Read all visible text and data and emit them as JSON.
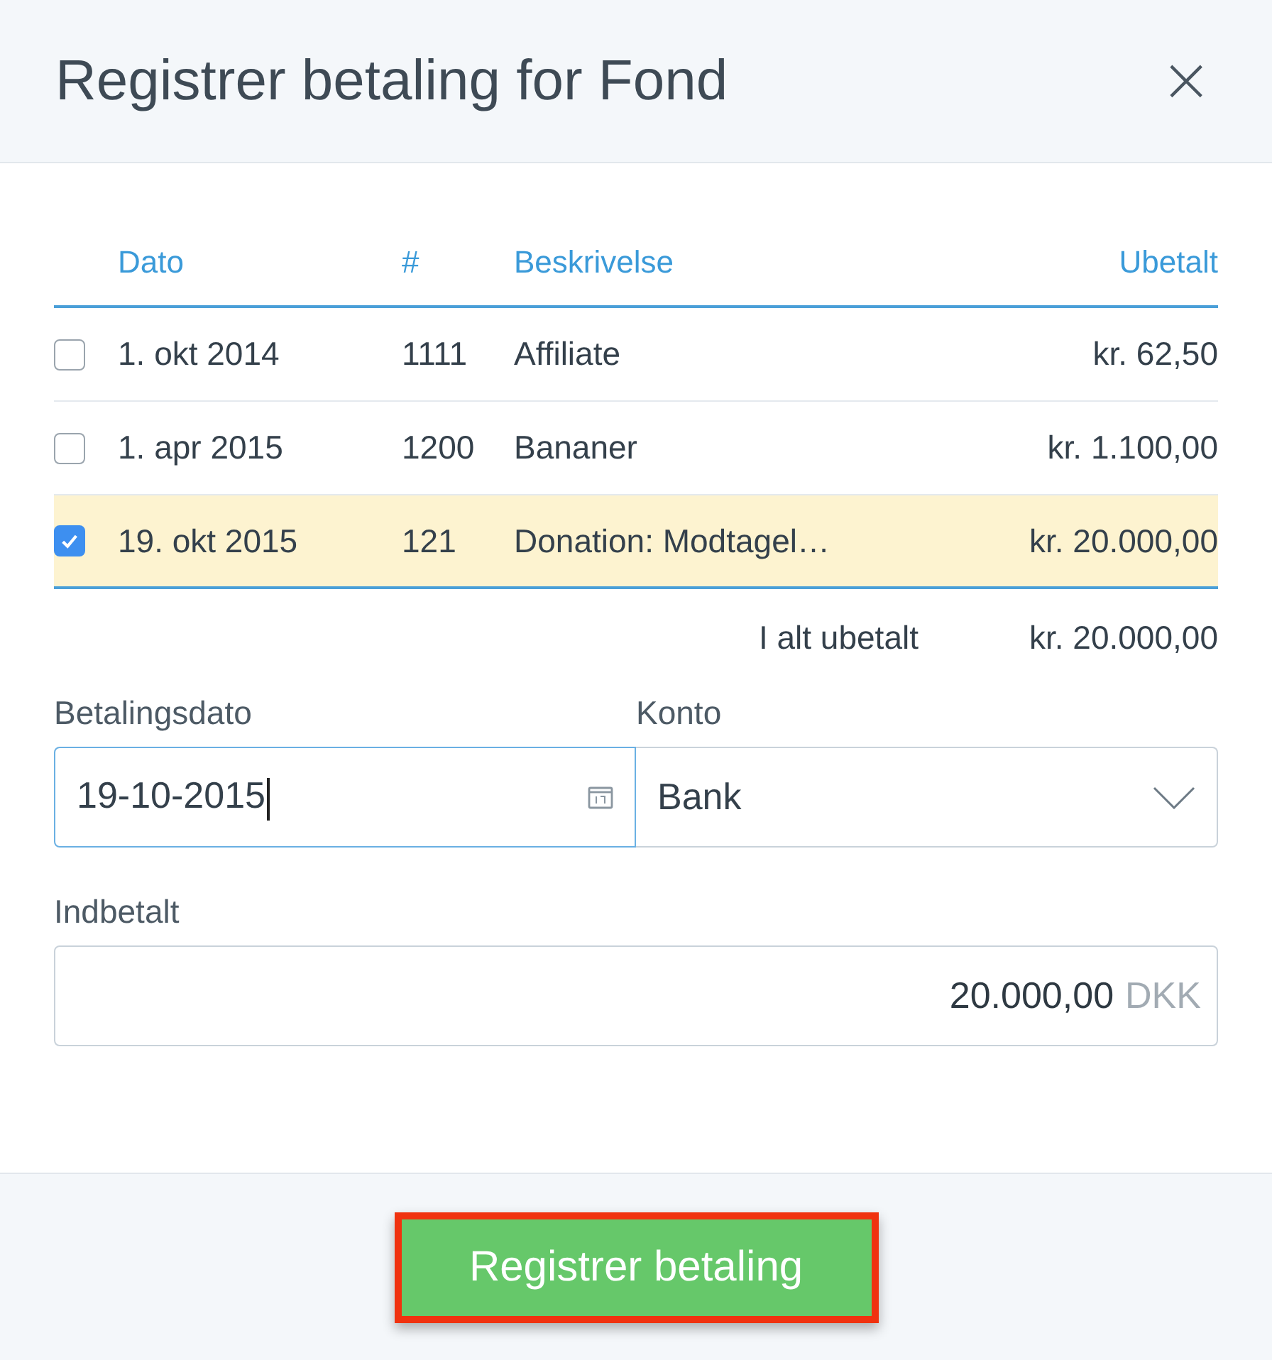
{
  "dialog": {
    "title": "Registrer betaling for Fond",
    "close": "×"
  },
  "table": {
    "columns": [
      "Dato",
      "#",
      "Beskrivelse",
      "Ubetalt"
    ],
    "rows": [
      {
        "selected": false,
        "date": "1. okt 2014",
        "number": "1111",
        "description": "Affiliate",
        "unpaid": "kr. 62,50"
      },
      {
        "selected": false,
        "date": "1. apr 2015",
        "number": "1200",
        "description": "Bananer",
        "unpaid": "kr. 1.100,00"
      },
      {
        "selected": true,
        "date": "19. okt 2015",
        "number": "121",
        "description": "Donation: Modtagel…",
        "unpaid": "kr. 20.000,00"
      }
    ],
    "total_label": "I alt ubetalt",
    "total_value": "kr. 20.000,00"
  },
  "payment_date": {
    "label": "Betalingsdato",
    "value": "19-10-2015",
    "focused": true
  },
  "account": {
    "label": "Konto",
    "value": "Bank"
  },
  "paid": {
    "label": "Indbetalt",
    "value": "20.000,00",
    "currency": "DKK"
  },
  "submit": {
    "label": "Registrer betaling",
    "highlighted": true
  }
}
